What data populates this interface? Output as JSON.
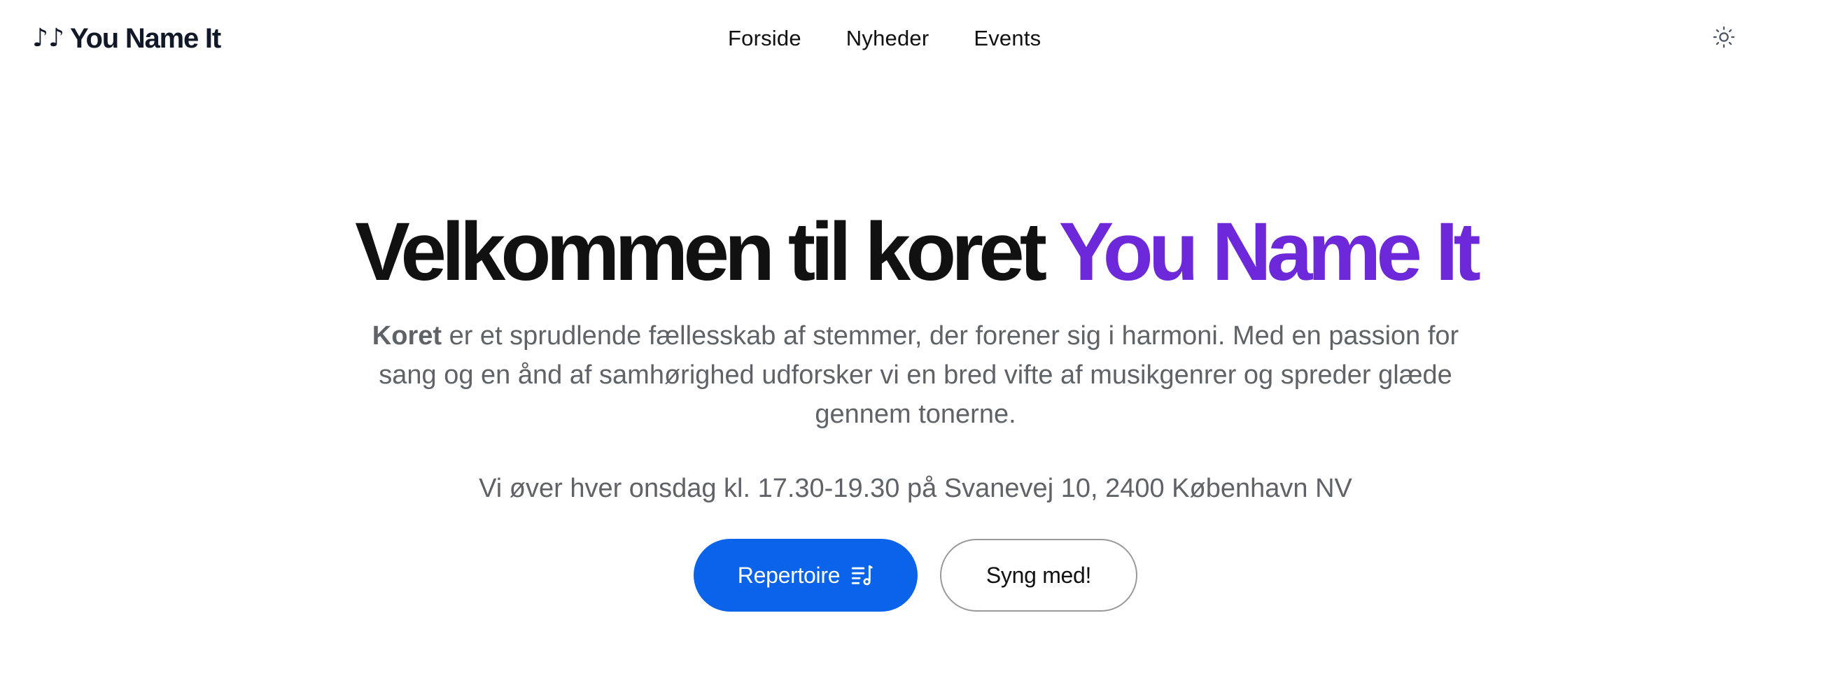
{
  "header": {
    "brand_icon": "music-notes-icon",
    "brand_glyph": "♪♪",
    "brand_name": "You Name It",
    "nav": [
      {
        "label": "Forside"
      },
      {
        "label": "Nyheder"
      },
      {
        "label": "Events"
      }
    ],
    "theme_toggle_icon": "sun-icon"
  },
  "hero": {
    "title_main": "Velkommen til koret",
    "title_accent": "You Name It",
    "desc_bold": "Koret",
    "desc_rest": " er et sprudlende fællesskab af stemmer, der forener sig i harmoni. Med en passion for sang og en ånd af samhørighed udforsker vi en bred vifte af musikgenrer og spreder glæde gennem tonerne.",
    "schedule": "Vi øver hver onsdag kl. 17.30-19.30 på Svanevej 10, 2400 København NV",
    "primary_button": "Repertoire",
    "primary_button_icon": "music-list-icon",
    "secondary_button": "Syng med!"
  },
  "colors": {
    "accent_purple": "#6d28d9",
    "primary_blue": "#0a63e8",
    "muted_text": "#5f6368"
  }
}
